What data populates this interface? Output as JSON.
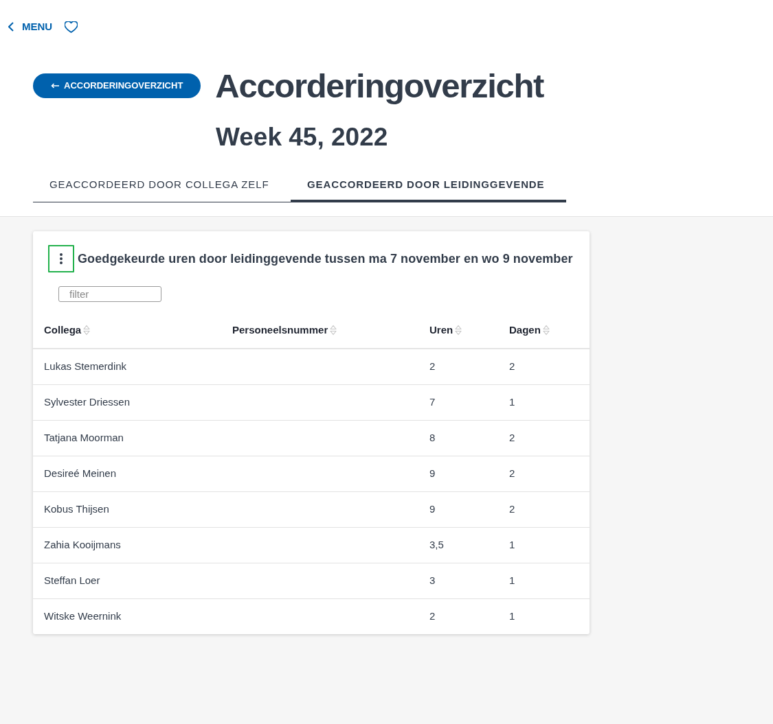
{
  "nav": {
    "back_label": "MENU"
  },
  "header": {
    "back_button": "ACCORDERINGOVERZICHT",
    "title": "Accorderingoverzicht",
    "subtitle": "Week 45, 2022"
  },
  "tabs": [
    {
      "label": "GEACCORDEERD DOOR COLLEGA ZELF",
      "selected": false
    },
    {
      "label": "GEACCORDEERD DOOR LEIDINGGEVENDE",
      "selected": true
    }
  ],
  "panel": {
    "menu_button": {
      "focused": true
    },
    "title": "Goedgekeurde uren door leidinggevende tussen ma 7 november en wo 9 november",
    "filter": {
      "placeholder": "filter"
    }
  },
  "table": {
    "columns": [
      "Collega",
      "Personeelsnummer",
      "Uren",
      "Dagen"
    ],
    "rows": [
      {
        "collega": "Lukas Stemerdink",
        "uren": "2",
        "dagen": "2"
      },
      {
        "collega": "Sylvester Driessen",
        "uren": "7",
        "dagen": "1"
      },
      {
        "collega": "Tatjana Moorman",
        "uren": "8",
        "dagen": "2"
      },
      {
        "collega": "Desireé Meinen",
        "uren": "9",
        "dagen": "2"
      },
      {
        "collega": "Kobus Thijsen",
        "uren": "9",
        "dagen": "2"
      },
      {
        "collega": "Zahia Kooijmans",
        "uren": "3,5",
        "dagen": "1"
      },
      {
        "collega": "Steffan Loer",
        "uren": "3",
        "dagen": "1"
      },
      {
        "collega": "Witske Weernink",
        "uren": "2",
        "dagen": "1"
      }
    ]
  }
}
